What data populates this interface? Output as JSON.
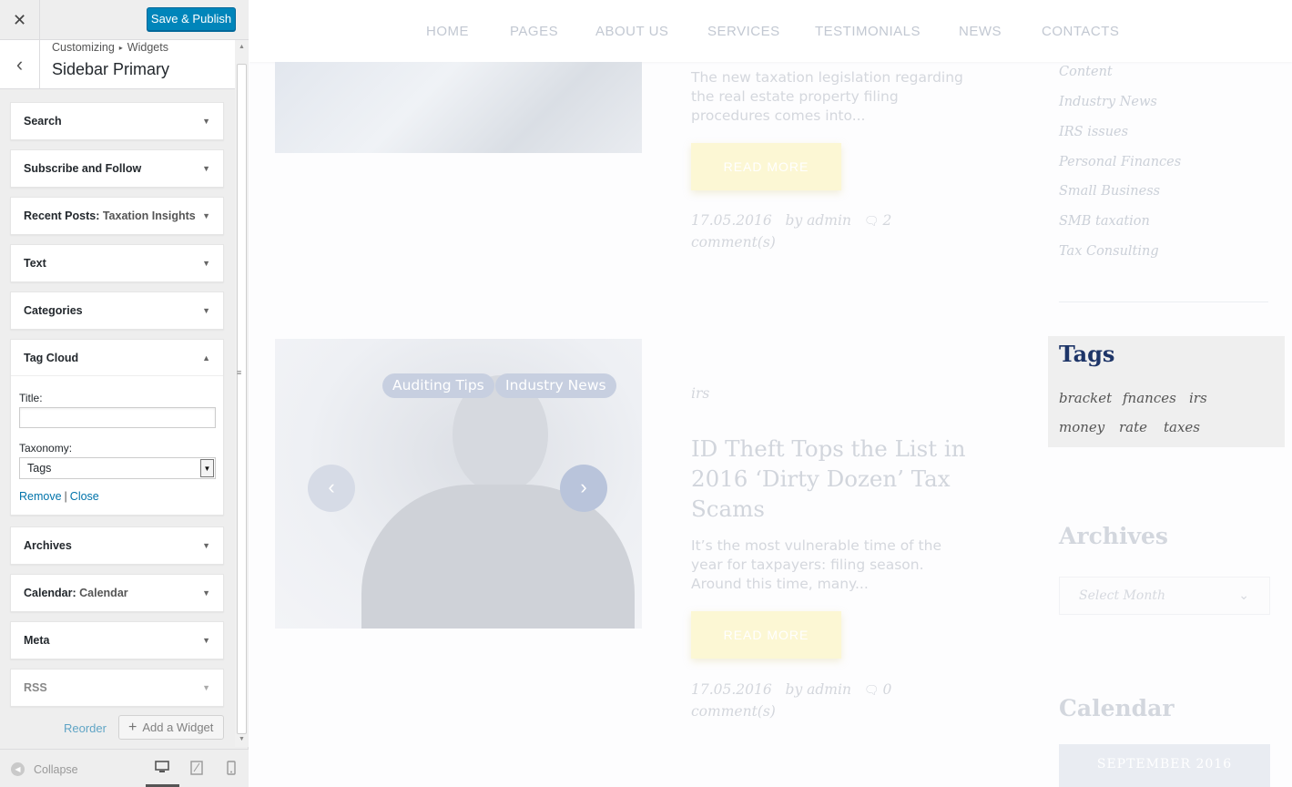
{
  "customizer": {
    "close_glyph": "✕",
    "save_label": "Save & Publish",
    "back_glyph": "‹",
    "breadcrumb": {
      "part1": "Customizing",
      "sep": "▸",
      "part2": "Widgets"
    },
    "section_title": "Sidebar Primary",
    "widgets": [
      {
        "title": "Search",
        "sub": ""
      },
      {
        "title": "Subscribe and Follow",
        "sub": ""
      },
      {
        "title": "Recent Posts:",
        "sub": "Taxation Insights"
      },
      {
        "title": "Text",
        "sub": ""
      },
      {
        "title": "Categories",
        "sub": ""
      },
      {
        "title": "Tag Cloud",
        "sub": ""
      },
      {
        "title": "Archives",
        "sub": ""
      },
      {
        "title": "Calendar:",
        "sub": "Calendar"
      },
      {
        "title": "Meta",
        "sub": ""
      },
      {
        "title": "RSS",
        "sub": ""
      }
    ],
    "tag_cloud_form": {
      "title_label": "Title:",
      "title_value": "",
      "taxonomy_label": "Taxonomy:",
      "taxonomy_value": "Tags",
      "remove_label": "Remove",
      "pipe": "|",
      "close_label": "Close"
    },
    "reorder_label": "Reorder",
    "add_widget_label": "Add a Widget",
    "collapse_label": "Collapse",
    "devices": [
      "desktop",
      "tablet",
      "mobile"
    ],
    "accent_color": "#0085ba"
  },
  "preview": {
    "nav": [
      "HOME",
      "PAGES",
      "ABOUT US",
      "SERVICES",
      "TESTIMONIALS",
      "NEWS",
      "CONTACTS"
    ],
    "post1": {
      "excerpt": "The new taxation legislation regarding the real estate property filing procedures comes into...",
      "read_more": "READ MORE",
      "date": "17.05.2016",
      "author": "by admin",
      "comments": "2",
      "comments_label": "comment(s)"
    },
    "post2": {
      "image_tags": [
        "Auditing Tips",
        "Industry News"
      ],
      "category": "irs",
      "title": "ID Theft Tops the List in 2016 ‘Dirty Dozen’ Tax Scams",
      "excerpt": "It’s the most vulnerable time of the year for taxpayers: filing season. Around this time, many...",
      "read_more": "READ MORE",
      "date": "17.05.2016",
      "author": "by admin",
      "comments": "0",
      "comments_label": "comment(s)"
    },
    "categories": [
      "Content",
      "Industry News",
      "IRS issues",
      "Personal Finances",
      "Small Business",
      "SMB taxation",
      "Tax Consulting"
    ],
    "tags_widget": {
      "title": "Tags",
      "tags": [
        "bracket",
        "fnances",
        "irs",
        "money",
        "rate",
        "taxes"
      ]
    },
    "archives": {
      "title": "Archives",
      "select_placeholder": "Select Month"
    },
    "calendar": {
      "title": "Calendar",
      "month": "SEPTEMBER 2016"
    },
    "tags_title_color": "#1e3568",
    "read_more_color": "#fcf7d4"
  }
}
